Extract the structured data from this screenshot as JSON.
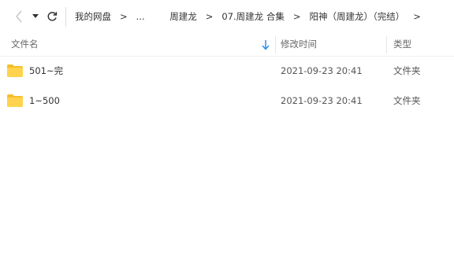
{
  "toolbar": {
    "back_icon": "chevron-left-icon",
    "dropdown_icon": "caret-down-icon",
    "refresh_icon": "refresh-icon"
  },
  "breadcrumb": {
    "items": [
      "我的网盘",
      "...",
      "周建龙",
      "07.周建龙 合集",
      "阳神（周建龙）（完结）"
    ],
    "separator": ">"
  },
  "columns": {
    "name": "文件名",
    "modified": "修改时间",
    "type": "类型"
  },
  "sort": {
    "icon": "arrow-down-icon",
    "color": "#2b8fe8"
  },
  "files": [
    {
      "name": "501~完",
      "modified": "2021-09-23 20:41",
      "type": "文件夹",
      "icon": "folder-icon"
    },
    {
      "name": "1~500",
      "modified": "2021-09-23 20:41",
      "type": "文件夹",
      "icon": "folder-icon"
    }
  ],
  "colors": {
    "folder": "#ffd34e",
    "folder_dark": "#f5bf2a",
    "text": "#333333",
    "header_text": "#666666"
  }
}
